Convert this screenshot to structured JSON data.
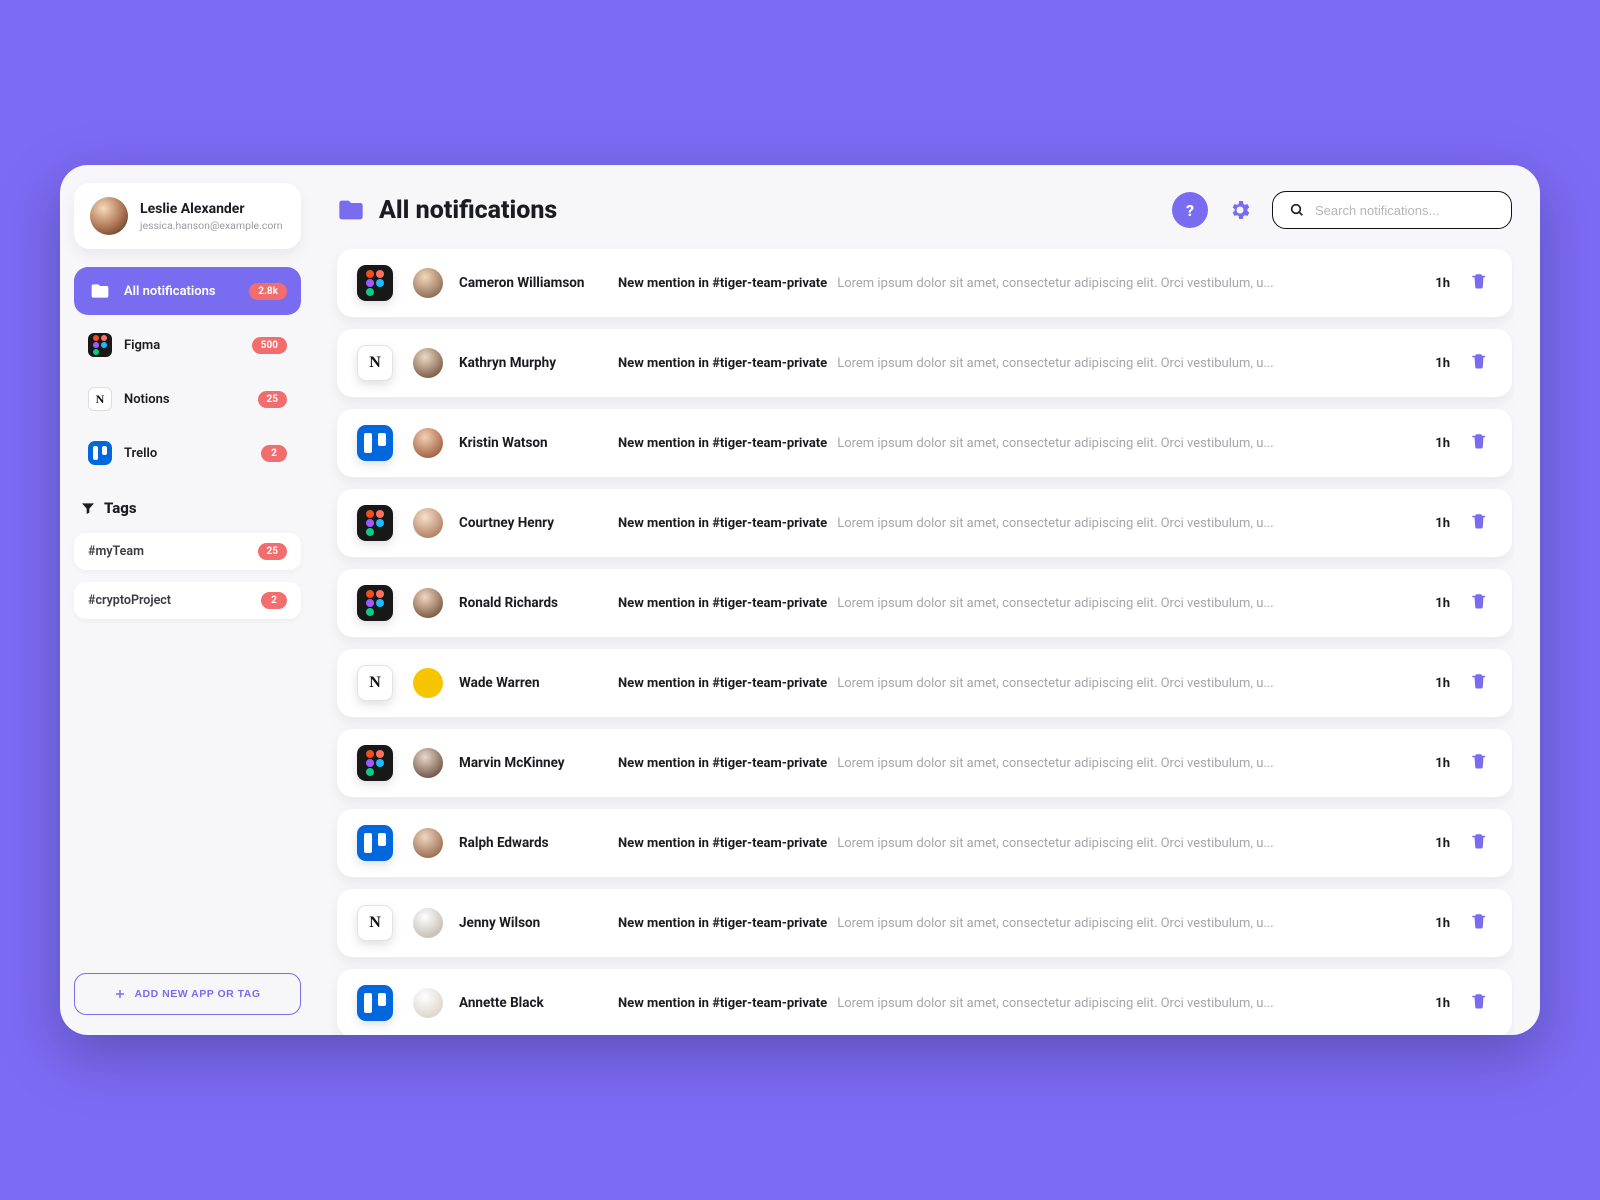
{
  "user": {
    "name": "Leslie Alexander",
    "email": "jessica.hanson@example.com"
  },
  "nav": [
    {
      "icon": "folder",
      "label": "All notifications",
      "badge": "2.8k",
      "active": true
    },
    {
      "icon": "figma",
      "label": "Figma",
      "badge": "500"
    },
    {
      "icon": "notion",
      "label": "Notions",
      "badge": "25"
    },
    {
      "icon": "trello",
      "label": "Trello",
      "badge": "2"
    }
  ],
  "tagsHeader": "Tags",
  "tags": [
    {
      "label": "#myTeam",
      "badge": "25"
    },
    {
      "label": "#cryptoProject",
      "badge": "2"
    }
  ],
  "addButton": "ADD NEW APP OR TAG",
  "page": {
    "title": "All notifications"
  },
  "search": {
    "placeholder": "Search notifications..."
  },
  "notifications": [
    {
      "app": "figma",
      "avatar": "av1",
      "person": "Cameron Williamson",
      "title": "New mention in #tiger-team-private",
      "body": "Lorem ipsum dolor sit amet, consectetur adipiscing elit. Orci vestibulum, u...",
      "time": "1h"
    },
    {
      "app": "notion",
      "avatar": "av2",
      "person": "Kathryn Murphy",
      "title": "New mention in #tiger-team-private",
      "body": "Lorem ipsum dolor sit amet, consectetur adipiscing elit. Orci vestibulum, u...",
      "time": "1h"
    },
    {
      "app": "trello",
      "avatar": "av3",
      "person": "Kristin Watson",
      "title": "New mention in #tiger-team-private",
      "body": "Lorem ipsum dolor sit amet, consectetur adipiscing elit. Orci vestibulum, u...",
      "time": "1h"
    },
    {
      "app": "figma",
      "avatar": "av4",
      "person": "Courtney Henry",
      "title": "New mention in #tiger-team-private",
      "body": "Lorem ipsum dolor sit amet, consectetur adipiscing elit. Orci vestibulum, u...",
      "time": "1h"
    },
    {
      "app": "figma",
      "avatar": "av5",
      "person": "Ronald Richards",
      "title": "New mention in #tiger-team-private",
      "body": "Lorem ipsum dolor sit amet, consectetur adipiscing elit. Orci vestibulum, u...",
      "time": "1h"
    },
    {
      "app": "notion",
      "avatar": "av6",
      "person": "Wade Warren",
      "title": "New mention in #tiger-team-private",
      "body": "Lorem ipsum dolor sit amet, consectetur adipiscing elit. Orci vestibulum, u...",
      "time": "1h"
    },
    {
      "app": "figma",
      "avatar": "av7",
      "person": "Marvin McKinney",
      "title": "New mention in #tiger-team-private",
      "body": "Lorem ipsum dolor sit amet, consectetur adipiscing elit. Orci vestibulum, u...",
      "time": "1h"
    },
    {
      "app": "trello",
      "avatar": "av8",
      "person": "Ralph Edwards",
      "title": "New mention in #tiger-team-private",
      "body": "Lorem ipsum dolor sit amet, consectetur adipiscing elit. Orci vestibulum, u...",
      "time": "1h"
    },
    {
      "app": "notion",
      "avatar": "av9",
      "person": "Jenny Wilson",
      "title": "New mention in #tiger-team-private",
      "body": "Lorem ipsum dolor sit amet, consectetur adipiscing elit. Orci vestibulum, u...",
      "time": "1h"
    },
    {
      "app": "trello",
      "avatar": "av10",
      "person": "Annette Black",
      "title": "New mention in #tiger-team-private",
      "body": "Lorem ipsum dolor sit amet, consectetur adipiscing elit. Orci vestibulum, u...",
      "time": "1h"
    }
  ]
}
